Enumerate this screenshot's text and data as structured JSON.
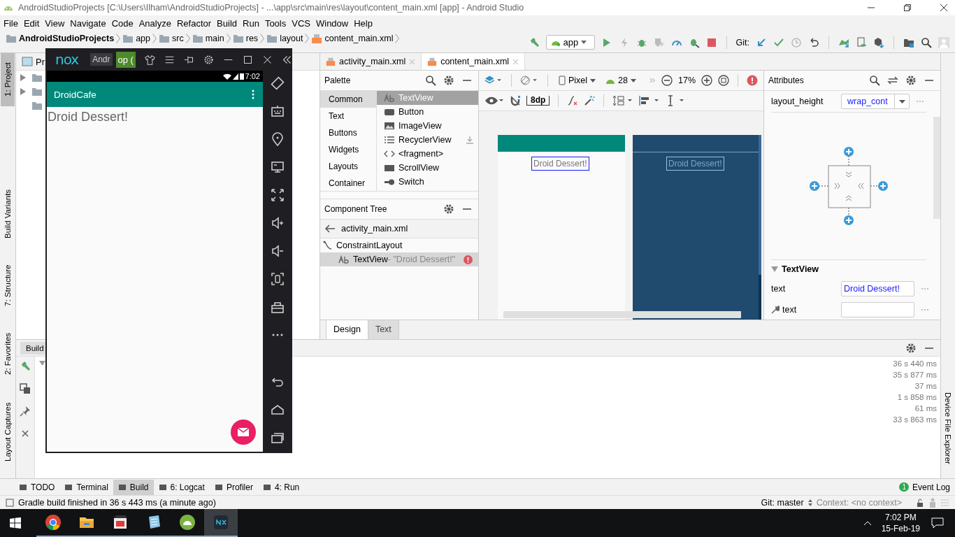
{
  "window": {
    "title": "AndroidStudioProjects [C:\\Users\\Ilham\\AndroidStudioProjects] - ...\\app\\src\\main\\res\\layout\\content_main.xml [app] - Android Studio"
  },
  "menu": [
    "File",
    "Edit",
    "View",
    "Navigate",
    "Code",
    "Analyze",
    "Refactor",
    "Build",
    "Run",
    "Tools",
    "VCS",
    "Window",
    "Help"
  ],
  "breadcrumb": [
    "AndroidStudioProjects",
    "app",
    "src",
    "main",
    "res",
    "layout",
    "content_main.xml"
  ],
  "toolbar": {
    "run_config": "app",
    "git_label": "Git:"
  },
  "left_stripe": [
    {
      "label": "1: Project",
      "selected": true
    },
    {
      "label": "Build Variants",
      "selected": false
    },
    {
      "label": "7: Structure",
      "selected": false
    },
    {
      "label": "2: Favorites",
      "selected": false
    },
    {
      "label": "Layout Captures",
      "selected": false
    }
  ],
  "right_stripe": [
    {
      "label": "Device File Explorer",
      "selected": false
    }
  ],
  "project_panel": {
    "title": "Pr",
    "tree": [
      {
        "expandable": true
      },
      {
        "expandable": true
      },
      {
        "expandable": false
      }
    ]
  },
  "editor_tabs": [
    {
      "label": "activity_main.xml",
      "selected": false
    },
    {
      "label": "content_main.xml",
      "selected": true
    }
  ],
  "palette": {
    "title": "Palette",
    "categories": [
      {
        "label": "Common",
        "selected": true
      },
      {
        "label": "Text",
        "selected": false
      },
      {
        "label": "Buttons",
        "selected": false
      },
      {
        "label": "Widgets",
        "selected": false
      },
      {
        "label": "Layouts",
        "selected": false
      },
      {
        "label": "Container",
        "selected": false
      }
    ],
    "items": [
      {
        "label": "TextView",
        "kind": "text",
        "selected": true
      },
      {
        "label": "Button",
        "kind": "button",
        "selected": false
      },
      {
        "label": "ImageView",
        "kind": "image",
        "selected": false
      },
      {
        "label": "RecyclerView",
        "kind": "list",
        "selected": false
      },
      {
        "label": "<fragment>",
        "kind": "fragment",
        "selected": false
      },
      {
        "label": "ScrollView",
        "kind": "scroll",
        "selected": false
      },
      {
        "label": "Switch",
        "kind": "switch",
        "selected": false
      }
    ]
  },
  "component_tree": {
    "title": "Component Tree",
    "parent": "activity_main.xml",
    "nodes": [
      {
        "label": "ConstraintLayout",
        "selected": false,
        "error": false,
        "children": [
          {
            "label": "TextView",
            "detail": "- \"Droid Dessert!\"",
            "selected": true,
            "error": true
          }
        ]
      }
    ]
  },
  "design_toolbar": {
    "device": "Pixel",
    "api": "28",
    "zoom": "17%",
    "margin": "8dp"
  },
  "canvas": {
    "design_text": "Droid Dessert!",
    "blueprint_text": "Droid Dessert!"
  },
  "design_tabs": [
    {
      "label": "Design",
      "selected": true
    },
    {
      "label": "Text",
      "selected": false
    }
  ],
  "attributes": {
    "title": "Attributes",
    "layout_height": {
      "label": "layout_height",
      "value": "wrap_cont"
    },
    "section": "TextView",
    "fields": [
      {
        "label": "text",
        "kind": "plain",
        "value": "Droid Dessert!"
      },
      {
        "label": "text",
        "kind": "tools"
      }
    ]
  },
  "build_panel": {
    "title": "Build",
    "times": [
      "36 s 440 ms",
      "35 s 877 ms",
      "37 ms",
      "1 s 858 ms",
      "61 ms",
      "33 s 863 ms"
    ]
  },
  "bottom_tabs": [
    {
      "label": "TODO",
      "selected": false
    },
    {
      "label": "Terminal",
      "selected": false
    },
    {
      "label": "Build",
      "selected": true
    },
    {
      "label": "6: Logcat",
      "selected": false
    },
    {
      "label": "Profiler",
      "selected": false
    },
    {
      "label": "4: Run",
      "selected": false
    }
  ],
  "event_log": {
    "label": "Event Log",
    "count": "1"
  },
  "status_bar": {
    "message": "Gradle build finished in 36 s 443 ms (a minute ago)",
    "git": "Git: master",
    "context": "Context: <no context>"
  },
  "emulator": {
    "logo": "nox",
    "tab": "Andr",
    "app_tab": "op (",
    "status_time": "7:02",
    "app_title": "DroidCafe",
    "content_text": "Droid Dessert!"
  },
  "taskbar": {
    "apps": [
      {
        "kind": "chrome",
        "selected": false
      },
      {
        "kind": "explorer",
        "selected": false
      },
      {
        "kind": "media",
        "selected": false
      },
      {
        "kind": "notepad",
        "selected": false
      },
      {
        "kind": "android",
        "selected": false
      },
      {
        "kind": "nox",
        "selected": true
      }
    ],
    "time": "7:02 PM",
    "date": "15-Feb-19"
  }
}
